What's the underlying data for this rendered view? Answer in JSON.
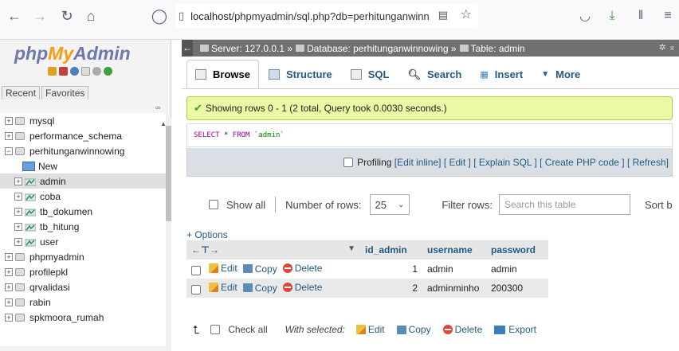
{
  "browser": {
    "url_host": "localhost",
    "url_path": "/phpmyadmin/sql.php?db=perhitunganwinnow"
  },
  "left_panel": {
    "logo_php": "php",
    "logo_my": "My",
    "logo_admin": "Admin",
    "tabs": [
      "Recent",
      "Favorites"
    ],
    "tree": [
      {
        "label": "mysql",
        "type": "db",
        "level": 0
      },
      {
        "label": "performance_schema",
        "type": "db",
        "level": 0
      },
      {
        "label": "perhitunganwinnowing",
        "type": "db",
        "level": 0,
        "expanded": true
      },
      {
        "label": "New",
        "type": "new",
        "level": 1
      },
      {
        "label": "admin",
        "type": "table",
        "level": 1,
        "selected": true
      },
      {
        "label": "coba",
        "type": "table",
        "level": 1
      },
      {
        "label": "tb_dokumen",
        "type": "table",
        "level": 1
      },
      {
        "label": "tb_hitung",
        "type": "table",
        "level": 1
      },
      {
        "label": "user",
        "type": "table",
        "level": 1
      },
      {
        "label": "phpmyadmin",
        "type": "db",
        "level": 0
      },
      {
        "label": "profilepkl",
        "type": "db",
        "level": 0
      },
      {
        "label": "qrvalidasi",
        "type": "db",
        "level": 0
      },
      {
        "label": "rabin",
        "type": "db",
        "level": 0
      },
      {
        "label": "spkmoora_rumah",
        "type": "db",
        "level": 0
      }
    ]
  },
  "breadcrumb": {
    "server": "Server: 127.0.0.1 »",
    "database": "Database: perhitunganwinnowing »",
    "table": "Table: admin"
  },
  "tabs": {
    "browse": "Browse",
    "structure": "Structure",
    "sql": "SQL",
    "search": "Search",
    "insert": "Insert",
    "more": "More"
  },
  "message": {
    "success": "Showing rows 0 - 1 (2 total, Query took 0.0030 seconds.)"
  },
  "sql": {
    "select": "SELECT",
    "star": "*",
    "from": "FROM",
    "table": "`admin`"
  },
  "profiling": {
    "profiling": "Profiling",
    "edit_inline": "[Edit inline]",
    "edit": "[ Edit ]",
    "explain": "[ Explain SQL ]",
    "create_php": "[ Create PHP code ]",
    "refresh": "[ Refresh]"
  },
  "navigation": {
    "show_all": "Show all",
    "number_of_rows": "Number of rows:",
    "rows_value": "25",
    "filter_rows": "Filter rows:",
    "search_placeholder": "Search this table",
    "sort_by": "Sort b"
  },
  "options_link": "+ Options",
  "table": {
    "columns": [
      "id_admin",
      "username",
      "password"
    ],
    "rows": [
      {
        "id_admin": "1",
        "username": "admin",
        "password": "admin"
      },
      {
        "id_admin": "2",
        "username": "adminminho",
        "password": "200300"
      }
    ],
    "actions": {
      "edit": "Edit",
      "copy": "Copy",
      "delete": "Delete"
    }
  },
  "bottom": {
    "check_all": "Check all",
    "with_selected": "With selected:",
    "edit": "Edit",
    "copy": "Copy",
    "delete": "Delete",
    "export": "Export"
  }
}
